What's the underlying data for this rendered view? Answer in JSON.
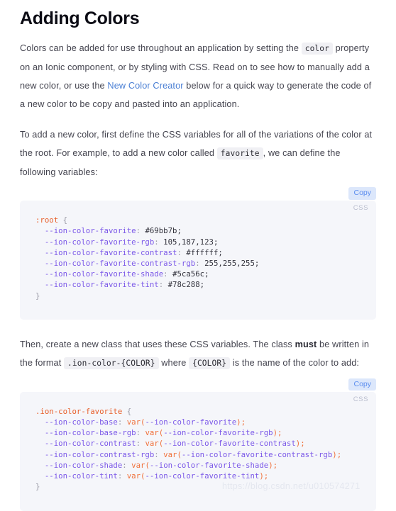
{
  "page": {
    "title": "Adding Colors"
  },
  "paragraphs": {
    "intro": {
      "part1": "Colors can be added for use throughout an application by setting the ",
      "code1": "color",
      "part2": " property on an Ionic component, or by styling with CSS. Read on to see how to manually add a new color, or use the ",
      "link": "New Color Creator",
      "part3": " below for a quick way to generate the code of a new color to be copy and pasted into an application."
    },
    "variables": {
      "part1": "To add a new color, first define the CSS variables for all of the variations of the color at the root. For example, to add a new color called ",
      "code1": "favorite",
      "part2": ", we can define the following variables:"
    },
    "classrule": {
      "part1": "Then, create a new class that uses these CSS variables. The class ",
      "bold": "must",
      "part2": " be written in the format ",
      "code1": ".ion-color-{COLOR}",
      "part3": " where ",
      "code2": "{COLOR}",
      "part4": " is the name of the color to add:"
    }
  },
  "code_block_1": {
    "copy_label": "Copy",
    "lang_label": "CSS",
    "lines": [
      {
        "selector": ":root",
        "brace": " {"
      },
      {
        "prop": "  --ion-color-favorite",
        "sep": ": ",
        "value": "#69bb7b;"
      },
      {
        "prop": "  --ion-color-favorite-rgb",
        "sep": ": ",
        "value": "105,187,123;"
      },
      {
        "prop": "  --ion-color-favorite-contrast",
        "sep": ": ",
        "value": "#ffffff;"
      },
      {
        "prop": "  --ion-color-favorite-contrast-rgb",
        "sep": ": ",
        "value": "255,255,255;"
      },
      {
        "prop": "  --ion-color-favorite-shade",
        "sep": ": ",
        "value": "#5ca56c;"
      },
      {
        "prop": "  --ion-color-favorite-tint",
        "sep": ": ",
        "value": "#78c288;"
      },
      {
        "close": "}"
      }
    ]
  },
  "code_block_2": {
    "copy_label": "Copy",
    "lang_label": "CSS",
    "lines": [
      {
        "selector": ".ion-color-favorite",
        "brace": " {"
      },
      {
        "prop": "  --ion-color-base",
        "sep": ": ",
        "fn": "var",
        "arg": "--ion-color-favorite",
        "tail": ");"
      },
      {
        "prop": "  --ion-color-base-rgb",
        "sep": ": ",
        "fn": "var",
        "arg": "--ion-color-favorite-rgb",
        "tail": ");"
      },
      {
        "prop": "  --ion-color-contrast",
        "sep": ": ",
        "fn": "var",
        "arg": "--ion-color-favorite-contrast",
        "tail": ");"
      },
      {
        "prop": "  --ion-color-contrast-rgb",
        "sep": ": ",
        "fn": "var",
        "arg": "--ion-color-favorite-contrast-rgb",
        "tail": ");"
      },
      {
        "prop": "  --ion-color-shade",
        "sep": ": ",
        "fn": "var",
        "arg": "--ion-color-favorite-shade",
        "tail": ");"
      },
      {
        "prop": "  --ion-color-tint",
        "sep": ": ",
        "fn": "var",
        "arg": "--ion-color-favorite-tint",
        "tail": ");"
      },
      {
        "close": "}"
      }
    ]
  },
  "watermark": {
    "text": "https://blog.csdn.net/u010574271"
  },
  "colors": {
    "link": "#4a7fd4",
    "copy_text": "#5b8def",
    "copy_bg": "#dce7fb",
    "code_bg": "#f5f6fa",
    "inline_code_bg": "#f0f0f4",
    "selector": "#e8602c",
    "property": "#7b58e8",
    "function": "#f0703a",
    "body_text": "#44444f"
  }
}
